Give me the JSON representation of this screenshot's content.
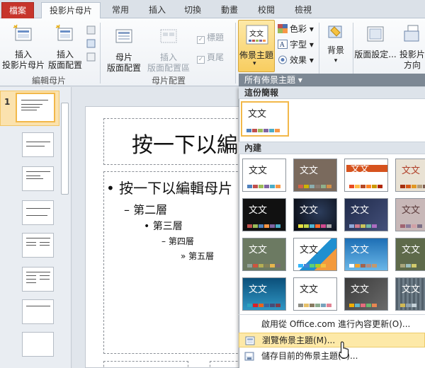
{
  "tabs": [
    {
      "label": "檔案"
    },
    {
      "label": "投影片母片"
    },
    {
      "label": "常用"
    },
    {
      "label": "插入"
    },
    {
      "label": "切換"
    },
    {
      "label": "動畫"
    },
    {
      "label": "校閱"
    },
    {
      "label": "檢視"
    }
  ],
  "ribbon": {
    "edit_master": {
      "group_label": "編輯母片",
      "insert_slide_master": [
        "插入",
        "投影片母片"
      ],
      "insert_layout": [
        "插入",
        "版面配置"
      ]
    },
    "master_layout": {
      "group_label": "母片配置",
      "master_layout_button": [
        "母片",
        "版面配置"
      ],
      "insert_placeholder": [
        "插入",
        "版面配置區"
      ],
      "title_check": "標題",
      "footer_check": "頁尾"
    },
    "theme": {
      "themes_button": "佈景主題",
      "colors": "色彩",
      "fonts": "字型",
      "effects": "效果",
      "background": "背景",
      "page_setup": "版面設定...",
      "orientation": [
        "投影片",
        "方向"
      ]
    },
    "dropdown_header": "所有佈景主題 ▾"
  },
  "thumbs": {
    "first_number": "1"
  },
  "slide": {
    "title": "按一下以編",
    "level1": "按一下以編輯母片",
    "level2": "第二層",
    "level3": "第三層",
    "level4": "第四層",
    "level5": "第五層"
  },
  "gallery": {
    "this_presentation": "這份簡報",
    "builtin": "內建",
    "sample_text": "文文",
    "menu": {
      "enable_updates": "啟用從 Office.com 進行內容更新(O)...",
      "browse_themes": "瀏覽佈景主題(M)...",
      "save_theme": "儲存目前的佈景主題(S)..."
    }
  }
}
